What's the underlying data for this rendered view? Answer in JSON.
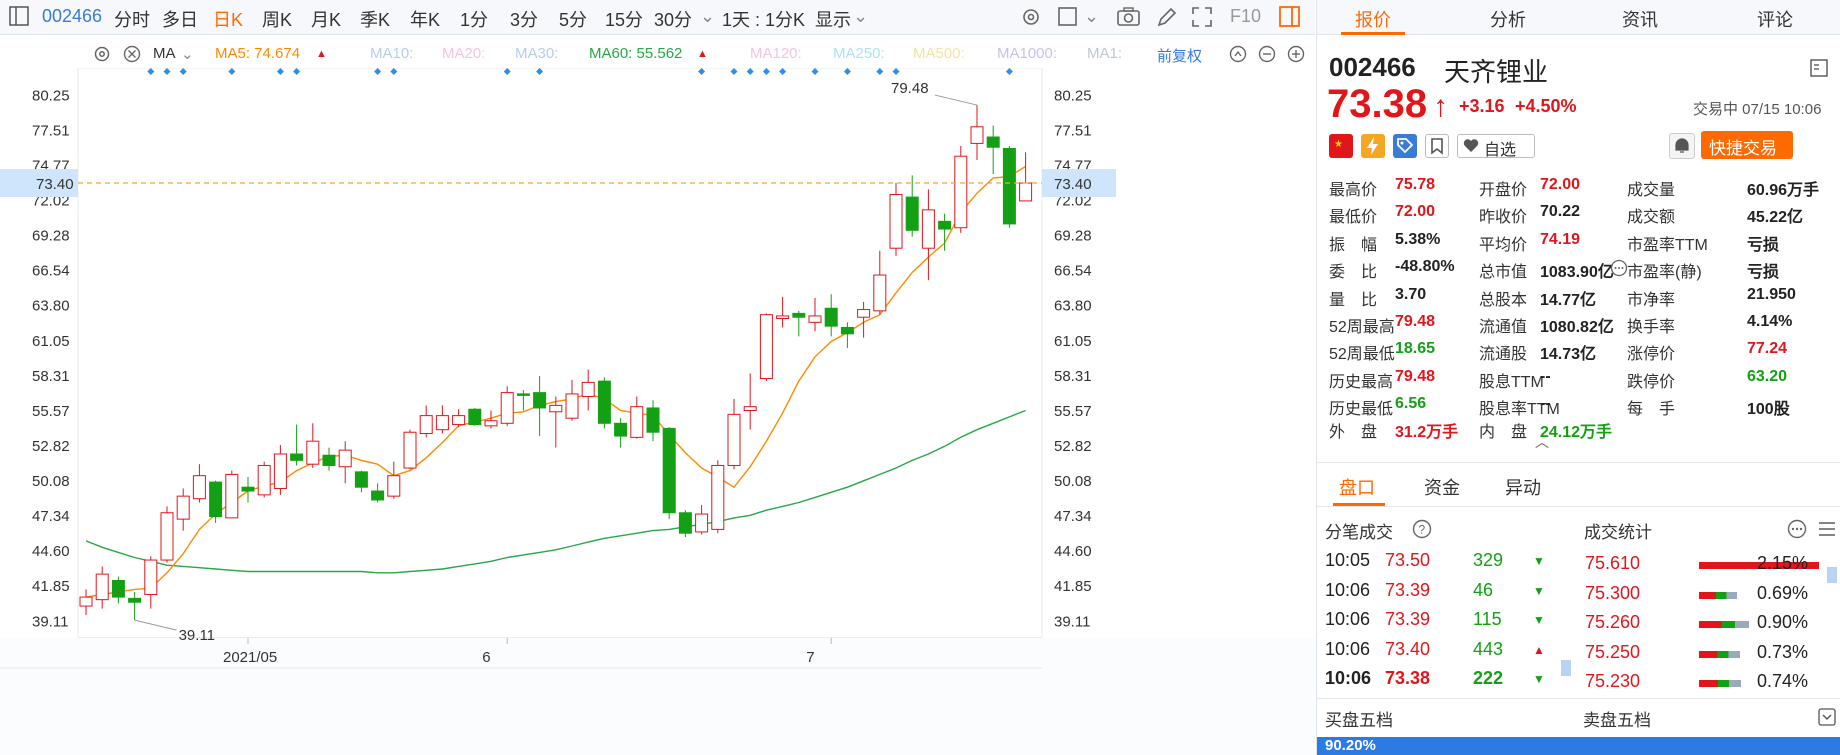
{
  "toolbar": {
    "code": "002466",
    "periods": [
      "分时",
      "多日",
      "日K",
      "周K",
      "月K",
      "季K",
      "年K",
      "1分",
      "3分",
      "5分",
      "15分",
      "30分"
    ],
    "active_period": "日K",
    "interval_select": "1天 : 1分K",
    "display_menu": "显示",
    "f10": "F10"
  },
  "ma_legend": {
    "selector": "MA",
    "ma5": "MA5: 74.674",
    "ma10": "MA10:",
    "ma20": "MA20:",
    "ma30": "MA30:",
    "ma60": "MA60: 55.562",
    "ma120": "MA120:",
    "ma250": "MA250:",
    "ma500": "MA500:",
    "ma1000": "MA1000:",
    "ma1": "MA1:",
    "adjust": "前复权"
  },
  "colors": {
    "up": "#e0161b",
    "down": "#14a014",
    "accent": "#ff6a00",
    "link": "#3a7bd5"
  },
  "chart_data": {
    "type": "candlestick",
    "y_ticks": [
      "80.25",
      "77.51",
      "74.77",
      "72.02",
      "69.28",
      "66.54",
      "63.80",
      "61.05",
      "58.31",
      "55.57",
      "52.82",
      "50.08",
      "47.34",
      "44.60",
      "41.85",
      "39.11"
    ],
    "ylim": [
      37.8,
      82.4
    ],
    "x_labels": [
      {
        "label": "2021/05",
        "index": 10
      },
      {
        "label": "6",
        "index": 26
      },
      {
        "label": "7",
        "index": 46
      }
    ],
    "current_price_label": "73.40",
    "current_price": 73.4,
    "max_label": "79.48",
    "min_label": "39.11",
    "candles": [
      {
        "o": 40.3,
        "c": 41.0,
        "h": 41.6,
        "l": 39.6
      },
      {
        "o": 40.8,
        "c": 42.8,
        "h": 43.4,
        "l": 40.1
      },
      {
        "o": 42.3,
        "c": 41.0,
        "h": 42.6,
        "l": 40.5
      },
      {
        "o": 40.9,
        "c": 40.6,
        "h": 41.4,
        "l": 39.2
      },
      {
        "o": 41.2,
        "c": 43.9,
        "h": 44.2,
        "l": 40.1
      },
      {
        "o": 43.9,
        "c": 47.6,
        "h": 48.1,
        "l": 43.7
      },
      {
        "o": 47.1,
        "c": 48.9,
        "h": 49.5,
        "l": 46.2
      },
      {
        "o": 48.7,
        "c": 50.5,
        "h": 51.4,
        "l": 48.4
      },
      {
        "o": 50.0,
        "c": 47.3,
        "h": 50.1,
        "l": 46.8
      },
      {
        "o": 47.2,
        "c": 50.6,
        "h": 50.9,
        "l": 47.2
      },
      {
        "o": 49.6,
        "c": 49.3,
        "h": 50.4,
        "l": 48.4
      },
      {
        "o": 49.0,
        "c": 51.3,
        "h": 51.6,
        "l": 48.8
      },
      {
        "o": 49.5,
        "c": 52.2,
        "h": 52.9,
        "l": 49.0
      },
      {
        "o": 52.2,
        "c": 51.7,
        "h": 54.5,
        "l": 51.3
      },
      {
        "o": 51.4,
        "c": 53.2,
        "h": 54.6,
        "l": 51.1
      },
      {
        "o": 52.1,
        "c": 51.3,
        "h": 52.7,
        "l": 50.9
      },
      {
        "o": 51.2,
        "c": 52.5,
        "h": 53.2,
        "l": 49.9
      },
      {
        "o": 50.8,
        "c": 49.6,
        "h": 50.9,
        "l": 49.2
      },
      {
        "o": 49.3,
        "c": 48.6,
        "h": 49.9,
        "l": 48.4
      },
      {
        "o": 48.9,
        "c": 50.5,
        "h": 51.6,
        "l": 48.7
      },
      {
        "o": 51.1,
        "c": 53.9,
        "h": 54.1,
        "l": 51.0
      },
      {
        "o": 53.8,
        "c": 55.2,
        "h": 56.0,
        "l": 53.5
      },
      {
        "o": 54.1,
        "c": 55.2,
        "h": 56.0,
        "l": 53.8
      },
      {
        "o": 54.5,
        "c": 55.2,
        "h": 55.7,
        "l": 54.3
      },
      {
        "o": 55.7,
        "c": 54.5,
        "h": 55.8,
        "l": 54.4
      },
      {
        "o": 54.4,
        "c": 54.8,
        "h": 55.6,
        "l": 54.2
      },
      {
        "o": 54.6,
        "c": 57.0,
        "h": 57.5,
        "l": 54.4
      },
      {
        "o": 56.9,
        "c": 56.8,
        "h": 57.2,
        "l": 55.6
      },
      {
        "o": 57.0,
        "c": 55.8,
        "h": 58.3,
        "l": 53.6
      },
      {
        "o": 55.5,
        "c": 56.0,
        "h": 56.7,
        "l": 52.7
      },
      {
        "o": 55.0,
        "c": 56.9,
        "h": 58.0,
        "l": 54.8
      },
      {
        "o": 56.7,
        "c": 57.8,
        "h": 58.8,
        "l": 55.6
      },
      {
        "o": 57.9,
        "c": 54.6,
        "h": 58.2,
        "l": 54.2
      },
      {
        "o": 54.6,
        "c": 53.6,
        "h": 55.0,
        "l": 52.7
      },
      {
        "o": 53.5,
        "c": 55.9,
        "h": 56.7,
        "l": 53.4
      },
      {
        "o": 55.8,
        "c": 53.9,
        "h": 56.4,
        "l": 53.2
      },
      {
        "o": 54.2,
        "c": 47.6,
        "h": 54.3,
        "l": 47.1
      },
      {
        "o": 47.6,
        "c": 46.0,
        "h": 47.8,
        "l": 45.7
      },
      {
        "o": 46.1,
        "c": 47.5,
        "h": 48.2,
        "l": 45.9
      },
      {
        "o": 46.3,
        "c": 51.3,
        "h": 51.7,
        "l": 46.0
      },
      {
        "o": 51.3,
        "c": 55.3,
        "h": 56.5,
        "l": 51.0
      },
      {
        "o": 55.6,
        "c": 55.9,
        "h": 58.5,
        "l": 54.1
      },
      {
        "o": 58.1,
        "c": 63.1,
        "h": 63.2,
        "l": 57.9
      },
      {
        "o": 62.8,
        "c": 63.0,
        "h": 64.5,
        "l": 62.1
      },
      {
        "o": 63.2,
        "c": 62.9,
        "h": 63.4,
        "l": 61.4
      },
      {
        "o": 62.5,
        "c": 63.0,
        "h": 64.4,
        "l": 61.8
      },
      {
        "o": 63.6,
        "c": 62.2,
        "h": 64.7,
        "l": 61.4
      },
      {
        "o": 62.1,
        "c": 61.6,
        "h": 62.5,
        "l": 60.5
      },
      {
        "o": 62.9,
        "c": 63.5,
        "h": 64.1,
        "l": 61.3
      },
      {
        "o": 63.4,
        "c": 66.2,
        "h": 68.1,
        "l": 63.1
      },
      {
        "o": 68.3,
        "c": 72.5,
        "h": 73.4,
        "l": 67.7
      },
      {
        "o": 72.3,
        "c": 69.7,
        "h": 74.0,
        "l": 69.2
      },
      {
        "o": 68.3,
        "c": 71.3,
        "h": 72.9,
        "l": 65.8
      },
      {
        "o": 70.4,
        "c": 69.8,
        "h": 71.0,
        "l": 68.1
      },
      {
        "o": 69.9,
        "c": 75.5,
        "h": 76.3,
        "l": 69.5
      },
      {
        "o": 76.5,
        "c": 77.8,
        "h": 79.5,
        "l": 75.2
      },
      {
        "o": 77.0,
        "c": 76.2,
        "h": 77.9,
        "l": 74.1
      },
      {
        "o": 76.1,
        "c": 70.2,
        "h": 76.3,
        "l": 69.9
      },
      {
        "o": 72.0,
        "c": 73.4,
        "h": 75.8,
        "l": 72.0
      }
    ],
    "ma5": [
      41.0,
      41.2,
      41.4,
      41.6,
      41.7,
      42.9,
      44.4,
      46.3,
      47.5,
      48.4,
      49.3,
      49.7,
      50.0,
      50.9,
      51.5,
      52.0,
      52.1,
      51.7,
      51.4,
      50.5,
      50.9,
      51.9,
      53.1,
      54.4,
      54.7,
      55.0,
      55.4,
      55.5,
      56.0,
      56.3,
      56.5,
      56.9,
      56.5,
      55.6,
      55.4,
      55.2,
      53.7,
      52.3,
      51.1,
      50.4,
      49.6,
      51.2,
      53.2,
      55.4,
      57.9,
      59.8,
      61.0,
      61.7,
      62.5,
      63.1,
      64.8,
      66.4,
      67.6,
      68.7,
      71.1,
      72.6,
      73.8,
      73.9,
      74.7
    ],
    "ma60": [
      45.4,
      44.9,
      44.5,
      44.1,
      43.8,
      43.5,
      43.4,
      43.3,
      43.2,
      43.1,
      43.0,
      43.0,
      43.0,
      43.0,
      43.0,
      43.0,
      43.0,
      43.0,
      42.9,
      42.9,
      43.0,
      43.1,
      43.2,
      43.4,
      43.6,
      43.8,
      44.1,
      44.3,
      44.5,
      44.7,
      45.0,
      45.3,
      45.6,
      45.8,
      46.0,
      46.2,
      46.3,
      46.5,
      46.7,
      46.9,
      47.2,
      47.4,
      47.8,
      48.1,
      48.4,
      48.8,
      49.2,
      49.6,
      50.1,
      50.6,
      51.1,
      51.7,
      52.2,
      52.8,
      53.5,
      54.1,
      54.6,
      55.1,
      55.6
    ]
  },
  "right_panel": {
    "tabs": [
      "报价",
      "分析",
      "资讯",
      "评论"
    ],
    "active_tab": "报价",
    "stock_code": "002466",
    "stock_name": "天齐锂业",
    "price": "73.38",
    "arrow": "↑",
    "change": "+3.16",
    "change_pct": "+4.50%",
    "status": "交易中 07/15 10:06",
    "watch_btn": "自选",
    "quick_trade": "快捷交易",
    "quote_grid": [
      [
        {
          "l": "最高价",
          "v": "75.78",
          "c": "red"
        },
        {
          "l": "开盘价",
          "v": "72.00",
          "c": "red"
        },
        {
          "l": "成交量",
          "v": "60.96万手",
          "c": "black"
        }
      ],
      [
        {
          "l": "最低价",
          "v": "72.00",
          "c": "red"
        },
        {
          "l": "昨收价",
          "v": "70.22",
          "c": "black"
        },
        {
          "l": "成交额",
          "v": "45.22亿",
          "c": "black"
        }
      ],
      [
        {
          "l": "振　幅",
          "v": "5.38%",
          "c": "black"
        },
        {
          "l": "平均价",
          "v": "74.19",
          "c": "red"
        },
        {
          "l": "市盈率TTM",
          "v": "亏损",
          "c": "black"
        }
      ],
      [
        {
          "l": "委　比",
          "v": "-48.80%",
          "c": "black"
        },
        {
          "l": "总市值",
          "v": "1083.90亿",
          "c": "black"
        },
        {
          "l": "市盈率(静)",
          "v": "亏损",
          "c": "black"
        }
      ],
      [
        {
          "l": "量　比",
          "v": "3.70",
          "c": "black"
        },
        {
          "l": "总股本",
          "v": "14.77亿",
          "c": "black"
        },
        {
          "l": "市净率",
          "v": "21.950",
          "c": "black"
        }
      ],
      [
        {
          "l": "52周最高",
          "v": "79.48",
          "c": "red"
        },
        {
          "l": "流通值",
          "v": "1080.82亿",
          "c": "black"
        },
        {
          "l": "换手率",
          "v": "4.14%",
          "c": "black"
        }
      ],
      [
        {
          "l": "52周最低",
          "v": "18.65",
          "c": "green"
        },
        {
          "l": "流通股",
          "v": "14.73亿",
          "c": "black"
        },
        {
          "l": "涨停价",
          "v": "77.24",
          "c": "red"
        }
      ],
      [
        {
          "l": "历史最高",
          "v": "79.48",
          "c": "red"
        },
        {
          "l": "股息TTM",
          "v": "--",
          "c": "black"
        },
        {
          "l": "跌停价",
          "v": "63.20",
          "c": "green"
        }
      ],
      [
        {
          "l": "历史最低",
          "v": "6.56",
          "c": "green"
        },
        {
          "l": "股息率TTM",
          "v": "--",
          "c": "black"
        },
        {
          "l": "每　手",
          "v": "100股",
          "c": "black"
        }
      ]
    ],
    "outer": {
      "l": "外　盘",
      "v": "31.2万手"
    },
    "inner": {
      "l": "内　盘",
      "v": "24.12万手"
    },
    "sub_tabs": [
      "盘口",
      "资金",
      "异动"
    ],
    "active_sub_tab": "盘口",
    "ticks_title": "分笔成交",
    "stats_title": "成交统计",
    "ticks": [
      {
        "t": "10:05",
        "p": "73.50",
        "v": "329",
        "dir": "down"
      },
      {
        "t": "10:06",
        "p": "73.39",
        "v": "46",
        "dir": "down"
      },
      {
        "t": "10:06",
        "p": "73.39",
        "v": "115",
        "dir": "down"
      },
      {
        "t": "10:06",
        "p": "73.40",
        "v": "443",
        "dir": "up"
      },
      {
        "t": "10:06",
        "p": "73.38",
        "v": "222",
        "dir": "down"
      }
    ],
    "stats": [
      {
        "p": "75.610",
        "pct": "2.15%",
        "frac": 1.0
      },
      {
        "p": "75.300",
        "pct": "0.69%",
        "frac": 0.32
      },
      {
        "p": "75.260",
        "pct": "0.90%",
        "frac": 0.42
      },
      {
        "p": "75.250",
        "pct": "0.73%",
        "frac": 0.34
      },
      {
        "p": "75.230",
        "pct": "0.74%",
        "frac": 0.35
      }
    ],
    "buy5": "买盘五档",
    "sell5": "卖盘五档",
    "bottom_pct": "90.20%"
  }
}
